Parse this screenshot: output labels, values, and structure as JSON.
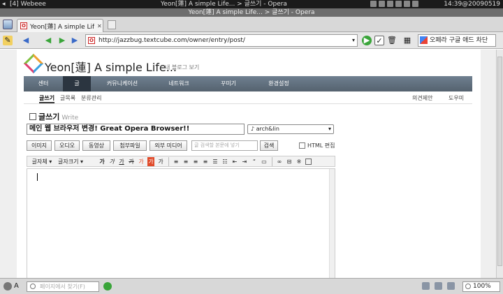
{
  "system": {
    "workspace": "[4] Webeee",
    "window_title": "Yeon[蓮] A simple Life... > 글쓰기 - Opera",
    "clock": "14:39@20090519"
  },
  "window": {
    "title": "Yeon[蓮] A simple Life... > 글쓰기 - Opera"
  },
  "tab": {
    "label": "Yeon[蓮] A simple Life...",
    "close": "✕"
  },
  "address": {
    "url": "http://jazzbug.textcube.com/owner/entry/post/",
    "search_engine": "오페라 구글 애드 차단"
  },
  "blog": {
    "title": "Yeon[蓮] A simple Life...",
    "view_link": "내 블로그 보기"
  },
  "main_nav": [
    "센터",
    "글",
    "커뮤니케이션",
    "네트워크",
    "꾸미기",
    "환경설정"
  ],
  "sub_nav": {
    "items": [
      "글쓰기",
      "글목록",
      "분류관리"
    ],
    "feedback": "의견제안",
    "help": "도우미"
  },
  "editor": {
    "heading": "글쓰기",
    "heading_sub": "Write",
    "post_title": "메인 웹 브라우저 변경! Great Opera Browser!!",
    "category": "arch&lin",
    "media_buttons": [
      "이미지",
      "오디오",
      "동영상",
      "첨부파일",
      "외부 미디어"
    ],
    "find_placeholder": "글 검색할 본문에 넣기",
    "search_button": "검색",
    "html_edit_label": "HTML 편집",
    "toolbar": {
      "font": "글자체",
      "size": "글자크기",
      "formats": [
        "가",
        "가",
        "가",
        "가",
        "가",
        "가",
        "가"
      ]
    }
  },
  "statusbar": {
    "find_placeholder": "페이지에서 찾기(F)",
    "zoom": "100%"
  }
}
